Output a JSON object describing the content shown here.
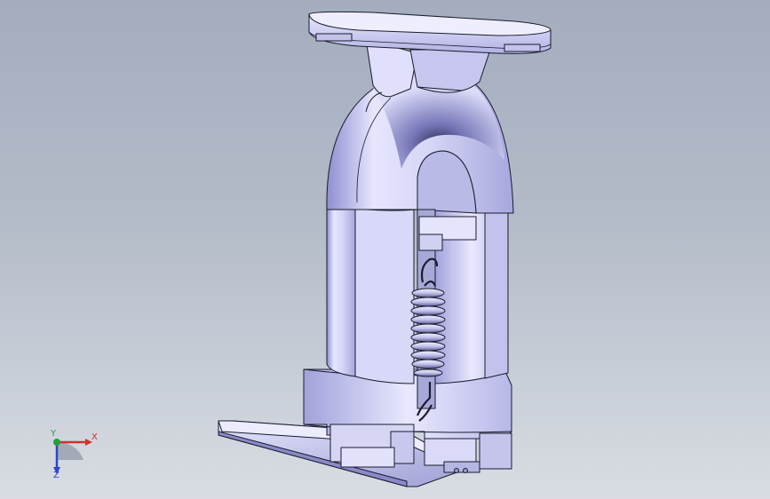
{
  "viewport": {
    "background_top": "#a3adbd",
    "background_bottom": "#d9dde3",
    "model_color": "#d4d4f6",
    "model_shade": "#9a9ad6",
    "edge_color": "#1b1b2e"
  },
  "triad": {
    "x_label": "X",
    "y_label": "Y",
    "z_label": "Z",
    "x_color": "#d0312d",
    "y_color": "#22a13a",
    "z_color": "#2a47c9"
  },
  "model": {
    "icon": "valve-assembly-3d-model"
  }
}
